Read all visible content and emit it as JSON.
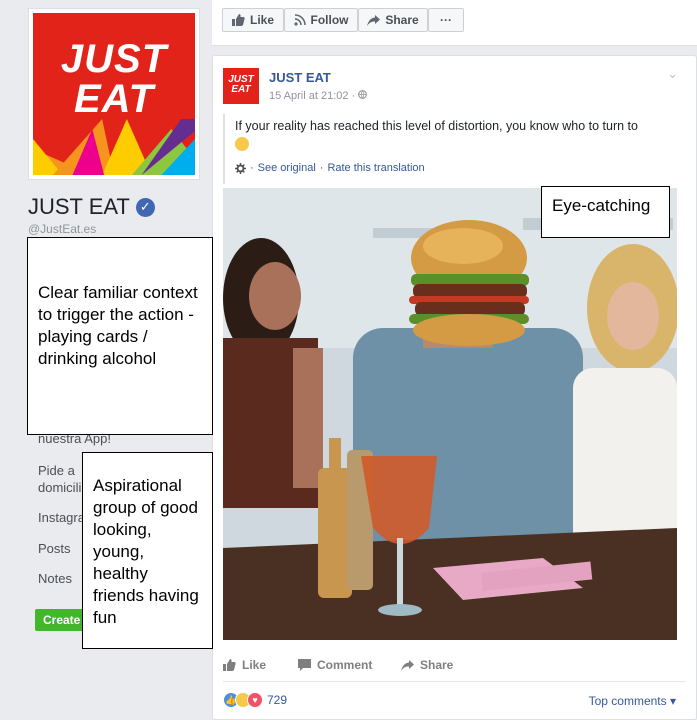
{
  "page": {
    "logo_text_line1": "JUST",
    "logo_text_line2": "EAT",
    "name": "JUST EAT",
    "verified_glyph": "✓",
    "handle": "@JustEat.es",
    "nav": {
      "app_item": "nuestra App!",
      "order_item_line1": "Pide a",
      "order_item_line2": "domicili",
      "instagram_item": "Instagra",
      "posts_item": "Posts",
      "notes_item": "Notes"
    },
    "create_button": "Create"
  },
  "action_bar": {
    "like": "Like",
    "follow": "Follow",
    "share": "Share",
    "more": "···"
  },
  "post": {
    "author": "JUST EAT",
    "avatar_line1": "JUST",
    "avatar_line2": "EAT",
    "timestamp": "15 April at 21:02 · ",
    "text": "If your reality has reached this level of distortion, you know who to turn to",
    "see_original": "See original",
    "separator": " · ",
    "rate_translation": "Rate this translation",
    "actions": {
      "like": "Like",
      "comment": "Comment",
      "share": "Share"
    },
    "reaction_count": "729",
    "top_comments": "Top comments ▾"
  },
  "annotations": {
    "eye_catching": "Eye-catching",
    "context": "Clear familiar context to trigger the action - playing cards / drinking alcohol",
    "aspirational": "Aspirational group of good looking, young, healthy friends having fun"
  },
  "colors": {
    "brand_red": "#e2231a",
    "fb_blue": "#365899",
    "create_green": "#42b72a"
  },
  "icons": [
    "verified-badge-icon",
    "thumbs-up-icon",
    "follow-rss-icon",
    "share-arrow-icon",
    "more-icon",
    "globe-icon",
    "gear-icon",
    "chevron-down-icon",
    "comment-icon",
    "like-reaction-icon",
    "haha-reaction-icon",
    "love-reaction-icon",
    "smile-emoji-icon"
  ]
}
